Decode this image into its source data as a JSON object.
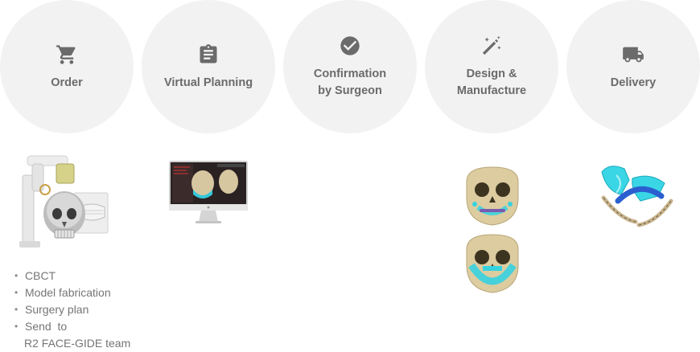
{
  "steps": [
    {
      "id": "order",
      "icon": "cart-icon",
      "lines": [
        "Order"
      ]
    },
    {
      "id": "virtual-planning",
      "icon": "clipboard-icon",
      "lines": [
        "Virtual Planning"
      ]
    },
    {
      "id": "confirmation",
      "icon": "check-circle-icon",
      "lines": [
        "Confirmation",
        "by Surgeon"
      ]
    },
    {
      "id": "design",
      "icon": "magic-wand-icon",
      "lines": [
        "Design &",
        "Manufacture"
      ]
    },
    {
      "id": "delivery",
      "icon": "truck-icon",
      "lines": [
        "Delivery"
      ]
    }
  ],
  "order_bullets": [
    "CBCT",
    "Model fabrication",
    "Surgery plan",
    "Send  to"
  ],
  "order_bullet_continuation": "R2 FACE-GIDE team",
  "colors": {
    "circle_bg": "#f2f2f2",
    "icon": "#6b6b6b",
    "text": "#6b6b6b",
    "bullet_text": "#757575",
    "cyan_guide": "#3ad6e6",
    "bone": "#d8c8a0"
  }
}
